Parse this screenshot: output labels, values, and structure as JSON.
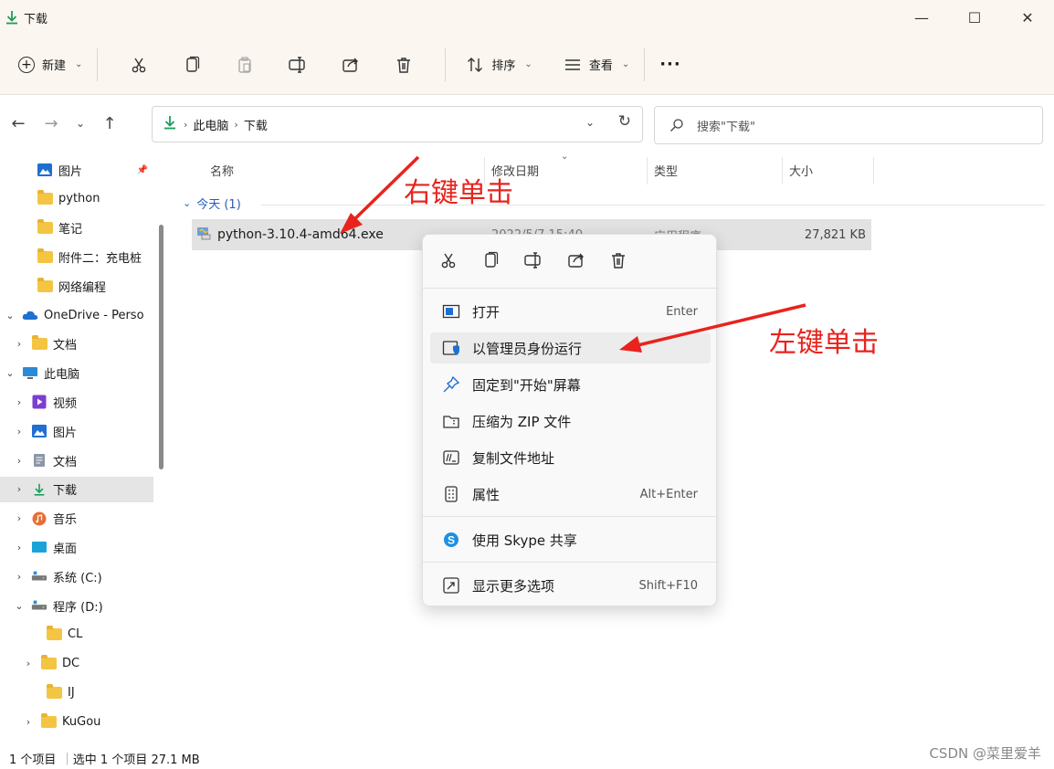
{
  "window": {
    "title": "下载",
    "minimize_glyph": "—",
    "maximize_glyph": "☐",
    "close_glyph": "✕"
  },
  "commandbar": {
    "new_label": "新建",
    "sort_label": "排序",
    "view_label": "查看",
    "more_glyph": "···"
  },
  "address": {
    "crumbs": [
      "此电脑",
      "下载"
    ],
    "search_placeholder": "搜索\"下载\""
  },
  "sidebar": {
    "items": [
      {
        "label": "图片",
        "icon": "pictures-icon",
        "indent": 1,
        "chevron": "",
        "pinned": true
      },
      {
        "label": "python",
        "icon": "folder-icon",
        "indent": 1,
        "chevron": ""
      },
      {
        "label": "笔记",
        "icon": "folder-icon",
        "indent": 1,
        "chevron": ""
      },
      {
        "label": "附件二：充电桩",
        "icon": "folder-icon",
        "indent": 1,
        "chevron": ""
      },
      {
        "label": "网络编程",
        "icon": "folder-icon",
        "indent": 1,
        "chevron": ""
      },
      {
        "label": "OneDrive - Perso",
        "icon": "onedrive-icon",
        "indent": 0,
        "chevron": "v"
      },
      {
        "label": "文档",
        "icon": "folder-icon",
        "indent": 1,
        "chevron": ">"
      },
      {
        "label": "此电脑",
        "icon": "pc-icon",
        "indent": 0,
        "chevron": "v"
      },
      {
        "label": "视频",
        "icon": "videos-icon",
        "indent": 1,
        "chevron": ">"
      },
      {
        "label": "图片",
        "icon": "pictures-icon",
        "indent": 1,
        "chevron": ">"
      },
      {
        "label": "文档",
        "icon": "documents-icon",
        "indent": 1,
        "chevron": ">"
      },
      {
        "label": "下载",
        "icon": "download-icon",
        "indent": 1,
        "chevron": ">",
        "selected": true
      },
      {
        "label": "音乐",
        "icon": "music-icon",
        "indent": 1,
        "chevron": ">"
      },
      {
        "label": "桌面",
        "icon": "desktop-icon",
        "indent": 1,
        "chevron": ">"
      },
      {
        "label": "系统 (C:)",
        "icon": "drive-icon",
        "indent": 1,
        "chevron": ">"
      },
      {
        "label": "程序 (D:)",
        "icon": "drive-icon",
        "indent": 1,
        "chevron": "v"
      },
      {
        "label": "CL",
        "icon": "folder-icon",
        "indent": 2,
        "chevron": ""
      },
      {
        "label": "DC",
        "icon": "folder-icon",
        "indent": 2,
        "chevron": ">"
      },
      {
        "label": "IJ",
        "icon": "folder-icon",
        "indent": 2,
        "chevron": ""
      },
      {
        "label": "KuGou",
        "icon": "folder-icon",
        "indent": 2,
        "chevron": ">"
      }
    ]
  },
  "filelist": {
    "columns": [
      "名称",
      "修改日期",
      "类型",
      "大小"
    ],
    "group_label": "今天 (1)",
    "rows": [
      {
        "name": "python-3.10.4-amd64.exe",
        "date": "2022/5/7 15:40",
        "type": "应用程序",
        "size": "27,821 KB"
      }
    ]
  },
  "context_menu": {
    "items": [
      {
        "label": "打开",
        "shortcut": "Enter",
        "icon": "open-icon"
      },
      {
        "label": "以管理员身份运行",
        "shortcut": "",
        "icon": "shield-icon"
      },
      {
        "label": "固定到\"开始\"屏幕",
        "shortcut": "",
        "icon": "pin-icon"
      },
      {
        "label": "压缩为 ZIP 文件",
        "shortcut": "",
        "icon": "zip-icon"
      },
      {
        "label": "复制文件地址",
        "shortcut": "",
        "icon": "copy-path-icon"
      },
      {
        "label": "属性",
        "shortcut": "Alt+Enter",
        "icon": "properties-icon"
      },
      {
        "label": "使用 Skype 共享",
        "shortcut": "",
        "icon": "skype-icon"
      },
      {
        "label": "显示更多选项",
        "shortcut": "Shift+F10",
        "icon": "more-options-icon"
      }
    ]
  },
  "annotations": {
    "right_click": "右键单击",
    "left_click": "左键单击"
  },
  "status": {
    "item_count": "1 个项目",
    "selection": "选中 1 个项目  27.1 MB",
    "watermark": "CSDN @菜里爱羊"
  },
  "colors": {
    "accent": "#0f7ad8",
    "annotation": "#e8231d",
    "download_green": "#1a9e5a"
  }
}
